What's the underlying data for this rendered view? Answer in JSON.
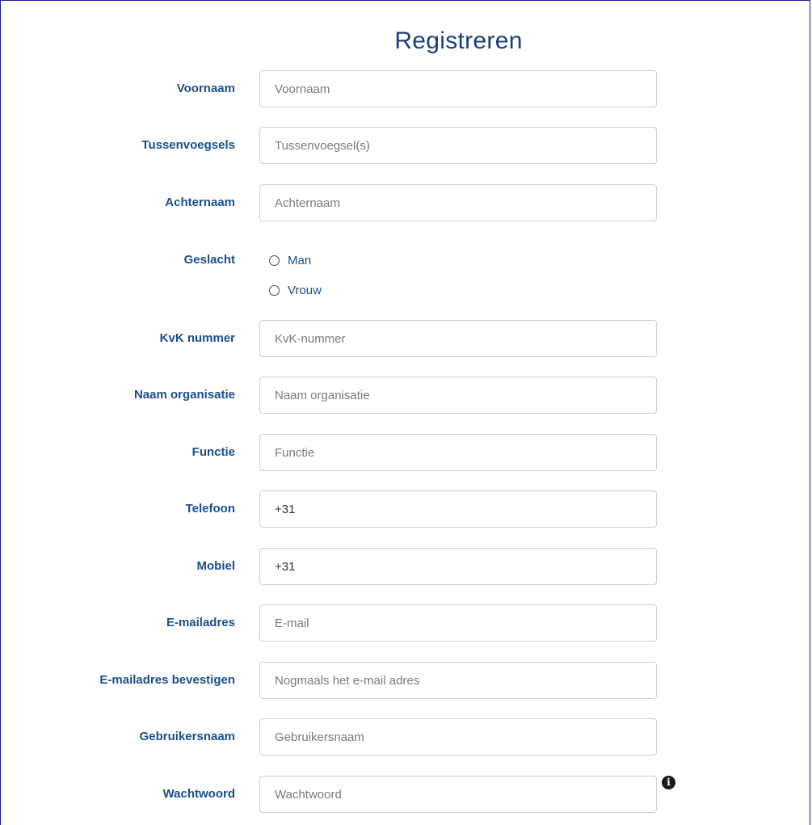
{
  "form": {
    "title": "Registreren",
    "fields": {
      "voornaam": {
        "label": "Voornaam",
        "placeholder": "Voornaam",
        "value": ""
      },
      "tussenvoegsels": {
        "label": "Tussenvoegsels",
        "placeholder": "Tussenvoegsel(s)",
        "value": ""
      },
      "achternaam": {
        "label": "Achternaam",
        "placeholder": "Achternaam",
        "value": ""
      },
      "geslacht": {
        "label": "Geslacht",
        "options": [
          "Man",
          "Vrouw"
        ]
      },
      "kvk": {
        "label": "KvK nummer",
        "placeholder": "KvK-nummer",
        "value": ""
      },
      "organisatie": {
        "label": "Naam organisatie",
        "placeholder": "Naam organisatie",
        "value": ""
      },
      "functie": {
        "label": "Functie",
        "placeholder": "Functie",
        "value": ""
      },
      "telefoon": {
        "label": "Telefoon",
        "placeholder": "",
        "value": "+31"
      },
      "mobiel": {
        "label": "Mobiel",
        "placeholder": "",
        "value": "+31"
      },
      "email": {
        "label": "E-mailadres",
        "placeholder": "E-mail",
        "value": ""
      },
      "email_confirm": {
        "label": "E-mailadres bevestigen",
        "placeholder": "Nogmaals het e-mail adres",
        "value": ""
      },
      "gebruikersnaam": {
        "label": "Gebruikersnaam",
        "placeholder": "Gebruikersnaam",
        "value": ""
      },
      "wachtwoord": {
        "label": "Wachtwoord",
        "placeholder": "Wachtwoord",
        "value": ""
      }
    },
    "icons": {
      "password_info": "info-icon"
    }
  },
  "colors": {
    "label": "#1b4e8c",
    "title": "#1b3f76",
    "border": "#cfcfcf"
  }
}
